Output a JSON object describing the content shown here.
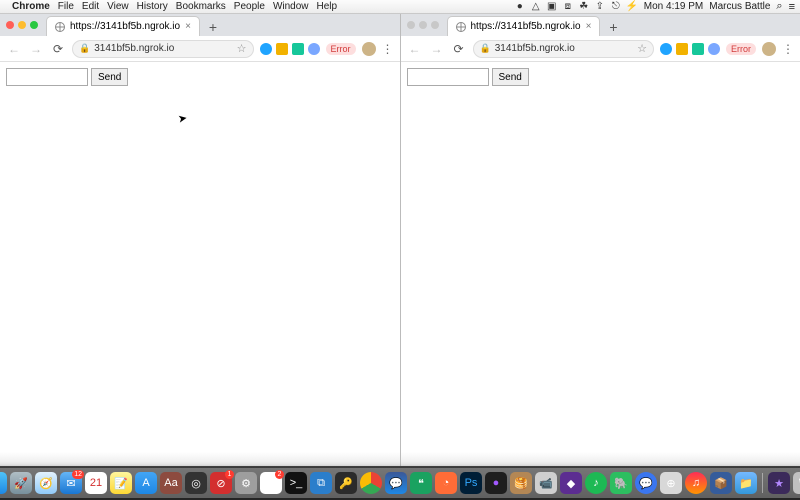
{
  "menubar": {
    "app": "Chrome",
    "items": [
      "File",
      "Edit",
      "View",
      "History",
      "Bookmarks",
      "People",
      "Window",
      "Help"
    ],
    "clock": "Mon 4:19 PM",
    "user": "Marcus Battle",
    "battery": "⚡"
  },
  "windows": [
    {
      "active": true,
      "tab_title": "https://3141bf5b.ngrok.io",
      "url": "3141bf5b.ngrok.io",
      "error_label": "Error",
      "send_label": "Send",
      "input_value": ""
    },
    {
      "active": false,
      "tab_title": "https://3141bf5b.ngrok.io",
      "url": "3141bf5b.ngrok.io",
      "error_label": "Error",
      "send_label": "Send",
      "input_value": ""
    }
  ],
  "extensions": [
    {
      "name": "opera-icon",
      "color": "#1fa4ff",
      "shape": "circle"
    },
    {
      "name": "yellow-ext",
      "color": "#f2b200",
      "shape": "square"
    },
    {
      "name": "teal-ext",
      "color": "#16c79a",
      "shape": "square"
    },
    {
      "name": "info-ext",
      "color": "#7aa7ff",
      "shape": "circle"
    }
  ],
  "dock": [
    {
      "name": "finder",
      "bg": "linear-gradient(#4fc3f7,#1e88e5)",
      "glyph": "☺"
    },
    {
      "name": "launchpad",
      "bg": "linear-gradient(#b0bec5,#78909c)",
      "glyph": "🚀"
    },
    {
      "name": "safari",
      "bg": "linear-gradient(#e3f2fd,#90caf9)",
      "glyph": "🧭"
    },
    {
      "name": "mail",
      "bg": "linear-gradient(#64b5f6,#1976d2)",
      "glyph": "✉",
      "badge": "12"
    },
    {
      "name": "calendar",
      "bg": "#ffffff",
      "glyph": "21",
      "text": "#d32f2f"
    },
    {
      "name": "notes",
      "bg": "linear-gradient(#fff59d,#fdd835)",
      "glyph": "📝"
    },
    {
      "name": "appstore",
      "bg": "linear-gradient(#42a5f5,#1e88e5)",
      "glyph": "A"
    },
    {
      "name": "dictionary",
      "bg": "#8d4b3f",
      "glyph": "Aa"
    },
    {
      "name": "activity",
      "bg": "#333",
      "glyph": "◎"
    },
    {
      "name": "stop",
      "bg": "#d32f2f",
      "glyph": "⊘",
      "badge": "1"
    },
    {
      "name": "settings",
      "bg": "#9e9e9e",
      "glyph": "⚙"
    },
    {
      "name": "slack",
      "bg": "#fff",
      "glyph": "❖",
      "badge": "2"
    },
    {
      "name": "terminal",
      "bg": "#111",
      "glyph": ">_"
    },
    {
      "name": "vscode",
      "bg": "#2b7ecb",
      "glyph": "⧉"
    },
    {
      "name": "1password",
      "bg": "#2b2b2b",
      "glyph": "🔑"
    },
    {
      "name": "chrome",
      "bg": "conic-gradient(#ea4335 0 120deg,#34a853 120deg 240deg,#fbbc05 240deg 360deg)",
      "glyph": "",
      "round": true
    },
    {
      "name": "messenger",
      "bg": "linear-gradient(#3b5998,#1e88e5)",
      "glyph": "💬"
    },
    {
      "name": "hangouts",
      "bg": "#1aa260",
      "glyph": "❝"
    },
    {
      "name": "postman",
      "bg": "#ff6c37",
      "glyph": "◔"
    },
    {
      "name": "photoshop",
      "bg": "#001e36",
      "glyph": "Ps",
      "text": "#31a8ff"
    },
    {
      "name": "figma",
      "bg": "#1e1e1e",
      "glyph": "●",
      "text": "#a259ff"
    },
    {
      "name": "sequel",
      "bg": "#b38755",
      "glyph": "🥞"
    },
    {
      "name": "zoom",
      "bg": "#cfcfcf",
      "glyph": "📹"
    },
    {
      "name": "affinity",
      "bg": "#5c2d91",
      "glyph": "◆"
    },
    {
      "name": "spotify",
      "bg": "#1db954",
      "glyph": "♪",
      "round": true
    },
    {
      "name": "evernote",
      "bg": "#2dbe60",
      "glyph": "🐘"
    },
    {
      "name": "signal",
      "bg": "#3a76f0",
      "glyph": "💬",
      "round": true
    },
    {
      "name": "zoom2",
      "bg": "#d8d8d8",
      "glyph": "⊕"
    },
    {
      "name": "itunes",
      "bg": "linear-gradient(#ff2d55,#ff9500)",
      "glyph": "♫",
      "round": true
    },
    {
      "name": "virtualbox",
      "bg": "#355c9b",
      "glyph": "📦"
    },
    {
      "name": "folder",
      "bg": "linear-gradient(#74b9ff,#3498db)",
      "glyph": "📁"
    },
    {
      "name": "imovie",
      "bg": "#3b2a5a",
      "glyph": "★",
      "text": "#b388ff"
    },
    {
      "name": "trash",
      "bg": "#c0c0c0",
      "glyph": "🗑"
    }
  ]
}
